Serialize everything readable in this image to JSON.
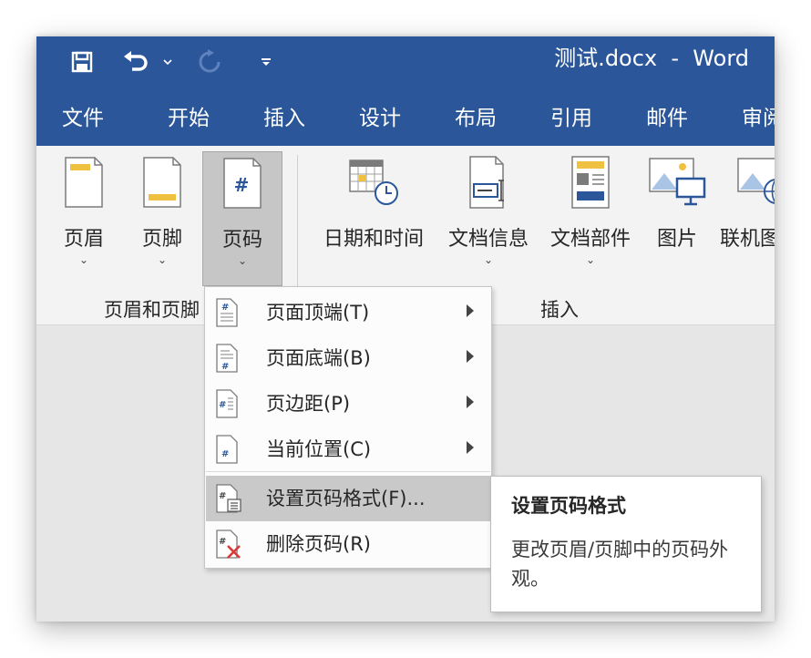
{
  "titlebar": {
    "title": "测试.docx  -  Word",
    "icons": [
      "save-icon",
      "undo-icon",
      "undo-dropdown-icon",
      "redo-icon",
      "customize-quick-access-icon"
    ]
  },
  "tabs": [
    "文件",
    "开始",
    "插入",
    "设计",
    "布局",
    "引用",
    "邮件",
    "审阅"
  ],
  "ribbon": {
    "header_footer": {
      "header_label": "页眉",
      "footer_label": "页脚",
      "page_number_label": "页码",
      "group_label": "页眉和页脚"
    },
    "insert": {
      "datetime_label": "日期和时间",
      "docinfo_label": "文档信息",
      "quickparts_label": "文档部件",
      "pictures_label": "图片",
      "online_pictures_label": "联机图片",
      "group_label": "插入"
    }
  },
  "page_number_menu": {
    "items": [
      {
        "label": "页面顶端(T)",
        "has_submenu": true
      },
      {
        "label": "页面底端(B)",
        "has_submenu": true
      },
      {
        "label": "页边距(P)",
        "has_submenu": true
      },
      {
        "label": "当前位置(C)",
        "has_submenu": true
      },
      {
        "label": "设置页码格式(F)...",
        "has_submenu": false,
        "highlighted": true
      },
      {
        "label": "删除页码(R)",
        "has_submenu": false
      }
    ]
  },
  "tooltip": {
    "title": "设置页码格式",
    "description": "更改页眉/页脚中的页码外观。"
  },
  "colors": {
    "title_bar": "#2b579a",
    "ribbon_background": "#f3f3f3",
    "highlight": "#c9c9c9",
    "accent_yellow": "#f0c040",
    "accent_blue": "#2b579a"
  }
}
